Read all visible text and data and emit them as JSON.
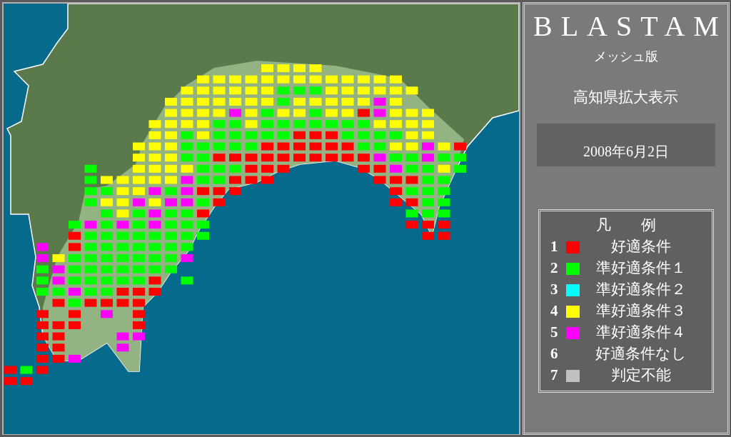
{
  "panel": {
    "title": "BLASTAM",
    "subtitle": "メッシュ版",
    "region": "高知県拡大表示",
    "date": "2008年6月2日"
  },
  "legend": {
    "title": "凡　　例",
    "items": [
      {
        "number": "1",
        "label": "好適条件",
        "color": "#ff0000"
      },
      {
        "number": "2",
        "label": "準好適条件１",
        "color": "#00ff00"
      },
      {
        "number": "3",
        "label": "準好適条件２",
        "color": "#00ffff"
      },
      {
        "number": "4",
        "label": "準好適条件３",
        "color": "#ffff00"
      },
      {
        "number": "5",
        "label": "準好適条件４",
        "color": "#ff00ff"
      },
      {
        "number": "6",
        "label": "好適条件なし"
      },
      {
        "number": "7",
        "label": "判定不能",
        "color": "#c0c0c0"
      }
    ]
  }
}
